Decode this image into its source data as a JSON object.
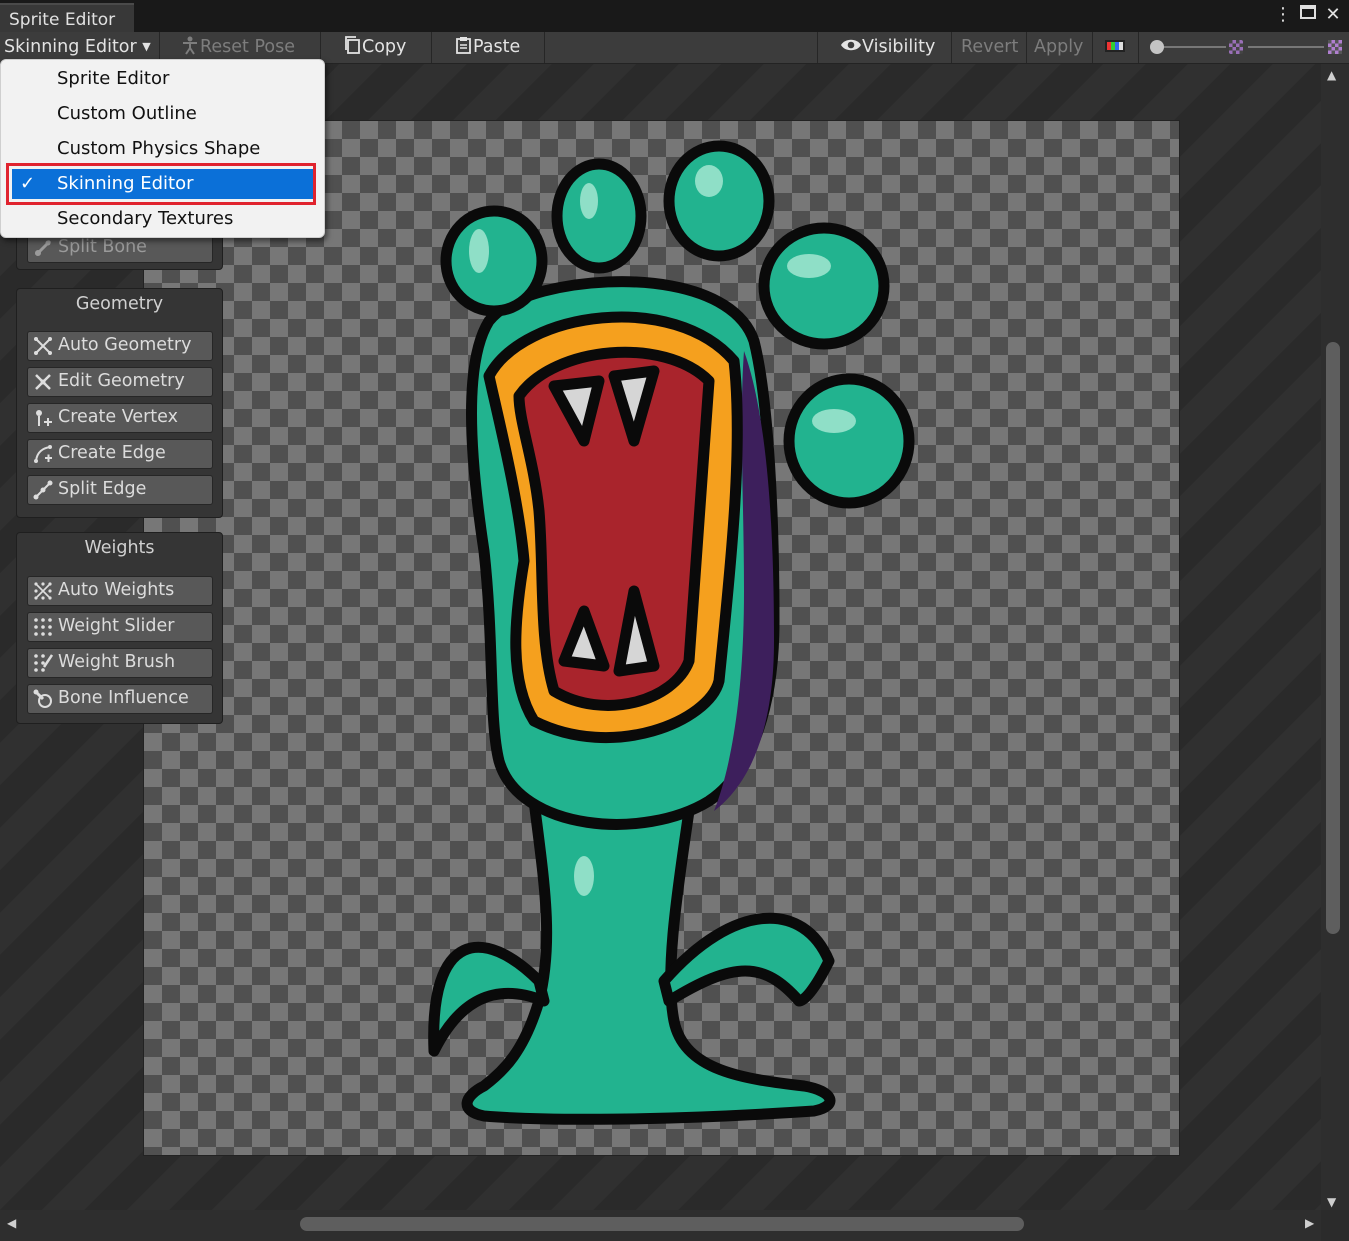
{
  "window": {
    "tab_title": "Sprite Editor"
  },
  "toolbar": {
    "mode_dropdown": "Skinning Editor",
    "reset_pose": "Reset Pose",
    "copy": "Copy",
    "paste": "Paste",
    "visibility": "Visibility",
    "revert": "Revert",
    "apply": "Apply"
  },
  "mode_menu": {
    "items": [
      {
        "label": "Sprite Editor",
        "checked": false
      },
      {
        "label": "Custom Outline",
        "checked": false
      },
      {
        "label": "Custom Physics Shape",
        "checked": false
      },
      {
        "label": "Skinning Editor",
        "checked": true
      },
      {
        "label": "Secondary Textures",
        "checked": false
      }
    ]
  },
  "bones_panel": {
    "partial_button": "Split Bone"
  },
  "geometry_panel": {
    "title": "Geometry",
    "buttons": [
      "Auto Geometry",
      "Edit Geometry",
      "Create Vertex",
      "Create Edge",
      "Split Edge"
    ]
  },
  "weights_panel": {
    "title": "Weights",
    "buttons": [
      "Auto Weights",
      "Weight Slider",
      "Weight Brush",
      "Bone Influence"
    ]
  },
  "colors": {
    "selection": "#0b70d8",
    "highlight_box": "#e0232e",
    "sprite_green": "#22b38f",
    "sprite_mouth_orange": "#f5a01e",
    "sprite_mouth_red": "#a9242c",
    "sprite_shadow_purple": "#3d1f5c"
  }
}
